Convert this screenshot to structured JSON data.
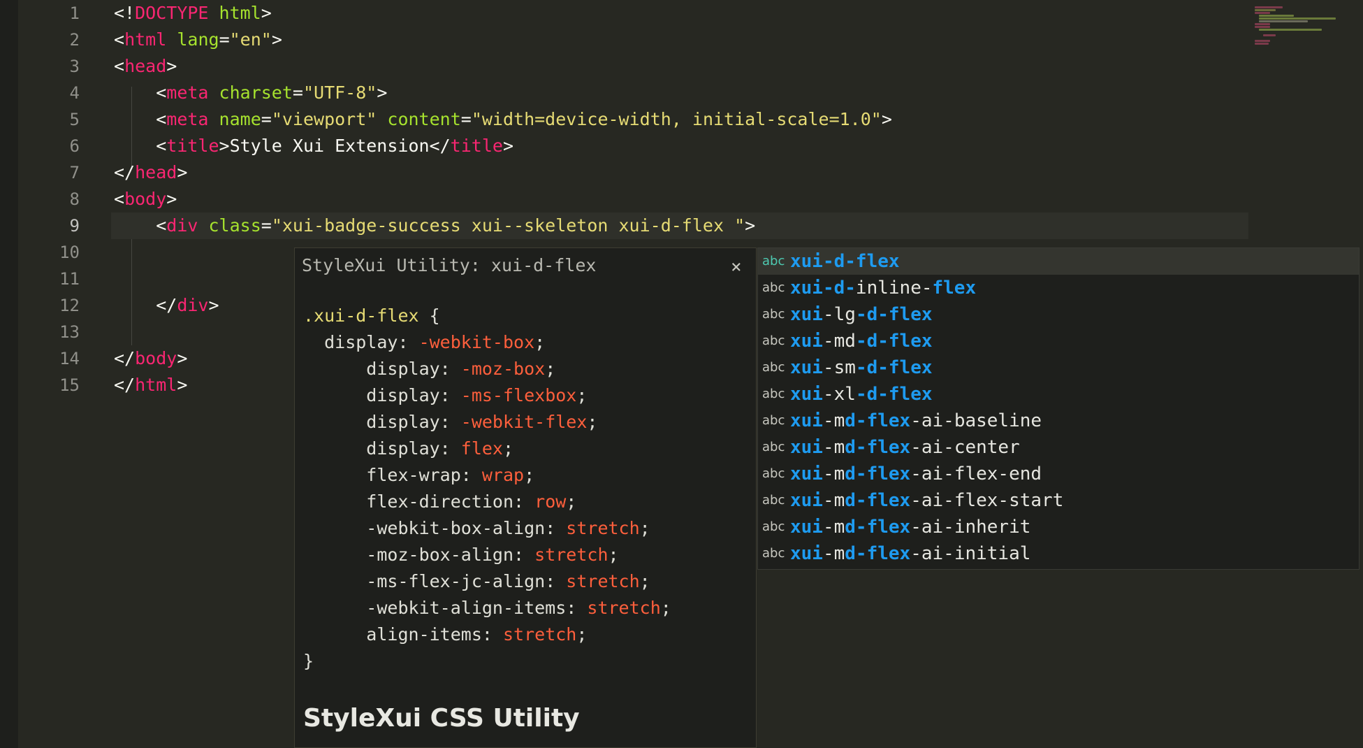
{
  "editor": {
    "line_numbers": [
      "1",
      "2",
      "3",
      "4",
      "5",
      "6",
      "7",
      "8",
      "9",
      "10",
      "11",
      "12",
      "13",
      "14",
      "15"
    ],
    "lines": [
      [
        {
          "c": "p",
          "t": "<!"
        },
        {
          "c": "t",
          "t": "DOCTYPE"
        },
        {
          "c": "p",
          "t": " "
        },
        {
          "c": "a",
          "t": "html"
        },
        {
          "c": "p",
          "t": ">"
        }
      ],
      [
        {
          "c": "p",
          "t": "<"
        },
        {
          "c": "t",
          "t": "html"
        },
        {
          "c": "p",
          "t": " "
        },
        {
          "c": "a",
          "t": "lang"
        },
        {
          "c": "p",
          "t": "="
        },
        {
          "c": "s",
          "t": "\"en\""
        },
        {
          "c": "p",
          "t": ">"
        }
      ],
      [
        {
          "c": "p",
          "t": "<"
        },
        {
          "c": "t",
          "t": "head"
        },
        {
          "c": "p",
          "t": ">"
        }
      ],
      [
        {
          "c": "p",
          "t": "    <"
        },
        {
          "c": "t",
          "t": "meta"
        },
        {
          "c": "p",
          "t": " "
        },
        {
          "c": "a",
          "t": "charset"
        },
        {
          "c": "p",
          "t": "="
        },
        {
          "c": "s",
          "t": "\"UTF-8\""
        },
        {
          "c": "p",
          "t": ">"
        }
      ],
      [
        {
          "c": "p",
          "t": "    <"
        },
        {
          "c": "t",
          "t": "meta"
        },
        {
          "c": "p",
          "t": " "
        },
        {
          "c": "a",
          "t": "name"
        },
        {
          "c": "p",
          "t": "="
        },
        {
          "c": "s",
          "t": "\"viewport\""
        },
        {
          "c": "p",
          "t": " "
        },
        {
          "c": "a",
          "t": "content"
        },
        {
          "c": "p",
          "t": "="
        },
        {
          "c": "s",
          "t": "\"width=device-width, initial-scale=1.0\""
        },
        {
          "c": "p",
          "t": ">"
        }
      ],
      [
        {
          "c": "p",
          "t": "    <"
        },
        {
          "c": "t",
          "t": "title"
        },
        {
          "c": "p",
          "t": ">Style Xui Extension</"
        },
        {
          "c": "t",
          "t": "title"
        },
        {
          "c": "p",
          "t": ">"
        }
      ],
      [
        {
          "c": "p",
          "t": "</"
        },
        {
          "c": "t",
          "t": "head"
        },
        {
          "c": "p",
          "t": ">"
        }
      ],
      [
        {
          "c": "p",
          "t": "<"
        },
        {
          "c": "t",
          "t": "body"
        },
        {
          "c": "p",
          "t": ">"
        }
      ],
      [
        {
          "c": "p",
          "t": "    <"
        },
        {
          "c": "t",
          "t": "div"
        },
        {
          "c": "p",
          "t": " "
        },
        {
          "c": "a",
          "t": "class"
        },
        {
          "c": "p",
          "t": "="
        },
        {
          "c": "s",
          "t": "\"xui-badge-success xui--skeleton xui-d-flex \""
        },
        {
          "c": "p",
          "t": ">"
        }
      ],
      [],
      [],
      [
        {
          "c": "p",
          "t": "    </"
        },
        {
          "c": "t",
          "t": "div"
        },
        {
          "c": "p",
          "t": ">"
        }
      ],
      [],
      [
        {
          "c": "p",
          "t": "</"
        },
        {
          "c": "t",
          "t": "body"
        },
        {
          "c": "p",
          "t": ">"
        }
      ],
      [
        {
          "c": "p",
          "t": "</"
        },
        {
          "c": "t",
          "t": "html"
        },
        {
          "c": "p",
          "t": ">"
        }
      ]
    ],
    "current_line": 9
  },
  "hover": {
    "title": "StyleXui Utility: xui-d-flex",
    "close_label": "×",
    "code": [
      [
        {
          "c": "sel",
          "t": ".xui-d-flex"
        },
        {
          "c": "prop",
          "t": " {"
        }
      ],
      [
        {
          "c": "prop",
          "t": "  display: "
        },
        {
          "c": "val",
          "t": "-webkit-box"
        },
        {
          "c": "prop",
          "t": ";"
        }
      ],
      [
        {
          "c": "prop",
          "t": "      display: "
        },
        {
          "c": "val",
          "t": "-moz-box"
        },
        {
          "c": "prop",
          "t": ";"
        }
      ],
      [
        {
          "c": "prop",
          "t": "      display: "
        },
        {
          "c": "val",
          "t": "-ms-flexbox"
        },
        {
          "c": "prop",
          "t": ";"
        }
      ],
      [
        {
          "c": "prop",
          "t": "      display: "
        },
        {
          "c": "val",
          "t": "-webkit-flex"
        },
        {
          "c": "prop",
          "t": ";"
        }
      ],
      [
        {
          "c": "prop",
          "t": "      display: "
        },
        {
          "c": "val",
          "t": "flex"
        },
        {
          "c": "prop",
          "t": ";"
        }
      ],
      [
        {
          "c": "prop",
          "t": "      flex-wrap: "
        },
        {
          "c": "val",
          "t": "wrap"
        },
        {
          "c": "prop",
          "t": ";"
        }
      ],
      [
        {
          "c": "prop",
          "t": "      flex-direction: "
        },
        {
          "c": "val",
          "t": "row"
        },
        {
          "c": "prop",
          "t": ";"
        }
      ],
      [
        {
          "c": "prop",
          "t": "      -webkit-box-align: "
        },
        {
          "c": "val",
          "t": "stretch"
        },
        {
          "c": "prop",
          "t": ";"
        }
      ],
      [
        {
          "c": "prop",
          "t": "      -moz-box-align: "
        },
        {
          "c": "val",
          "t": "stretch"
        },
        {
          "c": "prop",
          "t": ";"
        }
      ],
      [
        {
          "c": "prop",
          "t": "      -ms-flex-jc-align: "
        },
        {
          "c": "val",
          "t": "stretch"
        },
        {
          "c": "prop",
          "t": ";"
        }
      ],
      [
        {
          "c": "prop",
          "t": "      -webkit-align-items: "
        },
        {
          "c": "val",
          "t": "stretch"
        },
        {
          "c": "prop",
          "t": ";"
        }
      ],
      [
        {
          "c": "prop",
          "t": "      align-items: "
        },
        {
          "c": "val",
          "t": "stretch"
        },
        {
          "c": "prop",
          "t": ";"
        }
      ],
      [
        {
          "c": "prop",
          "t": "}"
        }
      ]
    ],
    "heading": "StyleXui CSS Utility"
  },
  "suggestions": {
    "icon_label": "abc",
    "selected_index": 0,
    "items": [
      [
        {
          "m": true,
          "t": "xui-d-flex"
        }
      ],
      [
        {
          "m": true,
          "t": "xui-d-"
        },
        {
          "m": false,
          "t": "inline-"
        },
        {
          "m": true,
          "t": "flex"
        }
      ],
      [
        {
          "m": true,
          "t": "xui"
        },
        {
          "m": false,
          "t": "-lg"
        },
        {
          "m": true,
          "t": "-d-flex"
        }
      ],
      [
        {
          "m": true,
          "t": "xui"
        },
        {
          "m": false,
          "t": "-md"
        },
        {
          "m": true,
          "t": "-d-flex"
        }
      ],
      [
        {
          "m": true,
          "t": "xui"
        },
        {
          "m": false,
          "t": "-sm"
        },
        {
          "m": true,
          "t": "-d-flex"
        }
      ],
      [
        {
          "m": true,
          "t": "xui"
        },
        {
          "m": false,
          "t": "-xl"
        },
        {
          "m": true,
          "t": "-d-flex"
        }
      ],
      [
        {
          "m": true,
          "t": "xui"
        },
        {
          "m": false,
          "t": "-m"
        },
        {
          "m": true,
          "t": "d-flex"
        },
        {
          "m": false,
          "t": "-ai-baseline"
        }
      ],
      [
        {
          "m": true,
          "t": "xui"
        },
        {
          "m": false,
          "t": "-m"
        },
        {
          "m": true,
          "t": "d-flex"
        },
        {
          "m": false,
          "t": "-ai-center"
        }
      ],
      [
        {
          "m": true,
          "t": "xui"
        },
        {
          "m": false,
          "t": "-m"
        },
        {
          "m": true,
          "t": "d-flex"
        },
        {
          "m": false,
          "t": "-ai-flex-end"
        }
      ],
      [
        {
          "m": true,
          "t": "xui"
        },
        {
          "m": false,
          "t": "-m"
        },
        {
          "m": true,
          "t": "d-flex"
        },
        {
          "m": false,
          "t": "-ai-flex-start"
        }
      ],
      [
        {
          "m": true,
          "t": "xui"
        },
        {
          "m": false,
          "t": "-m"
        },
        {
          "m": true,
          "t": "d-flex"
        },
        {
          "m": false,
          "t": "-ai-inherit"
        }
      ],
      [
        {
          "m": true,
          "t": "xui"
        },
        {
          "m": false,
          "t": "-m"
        },
        {
          "m": true,
          "t": "d-flex"
        },
        {
          "m": false,
          "t": "-ai-initial"
        }
      ]
    ]
  },
  "colors": {
    "background": "#272822",
    "tag": "#f92672",
    "attribute": "#a6e22e",
    "string": "#e6db74",
    "match_highlight": "#1e9bf0",
    "css_value": "#fd5f3c"
  }
}
